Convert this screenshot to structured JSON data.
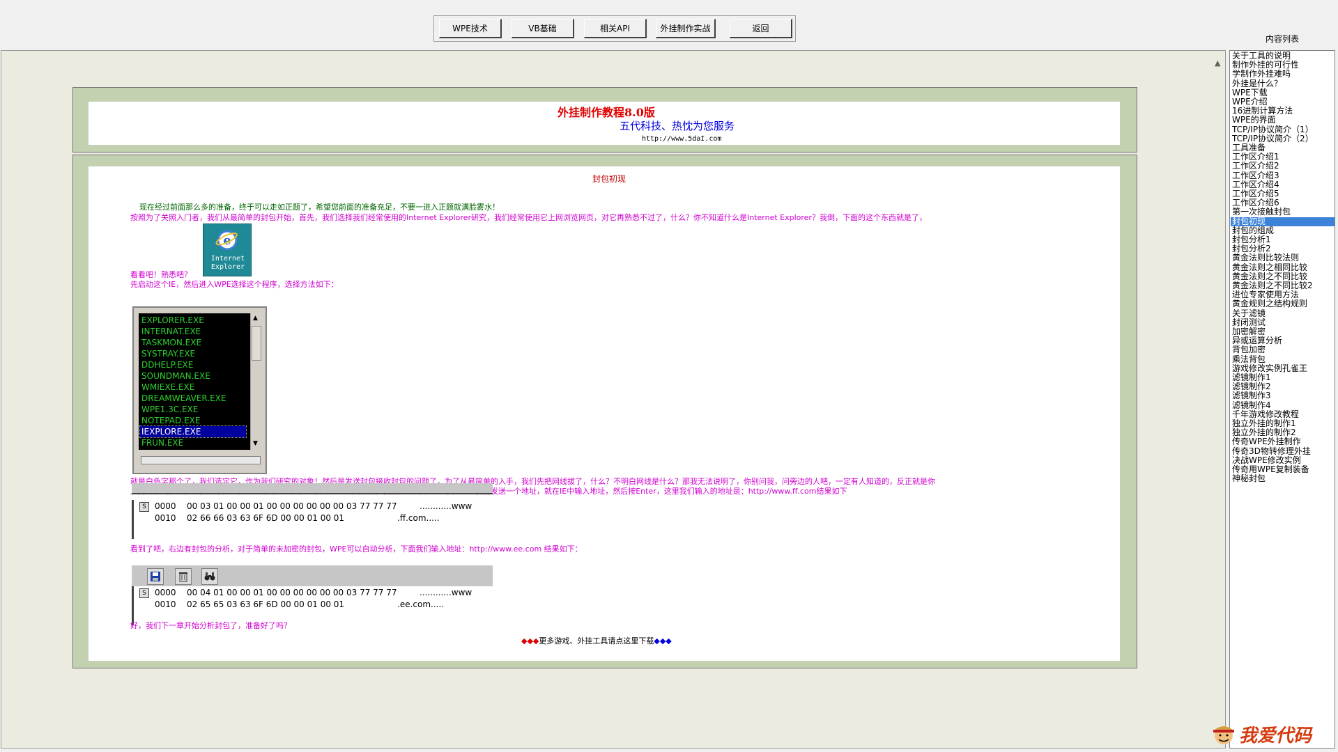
{
  "toolbar": {
    "buttons": [
      "WPE技术",
      "VB基础",
      "相关API",
      "外挂制作实战",
      "返回"
    ]
  },
  "header": {
    "title": "外挂制作教程8.0版",
    "subtitle": "五代科技、热忱为您服务",
    "url": "http://www.5daI.com"
  },
  "article": {
    "heading": "封包初现",
    "p1": "现在经过前面那么多的准备，终于可以走如正题了，希望您前面的准备充足，不要一进入正题就满脸雾水！",
    "p2": "按照为了关照入门者，我们从最简单的封包开始，首先，我们选择我们经常使用的Internet Explorer研究，我们经常使用它上网浏览网页，对它再熟悉不过了，什么？你不知道什么是Internet Explorer？我倒，下面的这个东西就是了，",
    "ie_label_1": "Internet",
    "ie_label_2": "Explorer",
    "p3": "看看吧！熟悉吧？",
    "p4": "先启动这个IE，然后进入WPE选择这个程序，选择方法如下：",
    "processes": [
      "EXPLORER.EXE",
      "INTERNAT.EXE",
      "TASKMON.EXE",
      "SYSTRAY.EXE",
      "DDHELP.EXE",
      "SOUNDMAN.EXE",
      "WMIEXE.EXE",
      "DREAMWEAVER.EXE",
      "WPE1.3C.EXE",
      "NOTEPAD.EXE",
      "IEXPLORE.EXE",
      "FRUN.EXE"
    ],
    "selected_process": "IEXPLORE.EXE",
    "p5a": "就是白色字那个了，我们选定它，作为我们研究的对象！然后是发送封包接收封包的问题了，为了从最简单的入手，我们先把网线拔了，什么？不明白网线是什么？那我无法说明了，你别问我，问旁边的人吧，一定有人知道的，反正就是你",
    "p5b": "上网那根线，先把它拔下来，这样就没有封包返回，方便研究！下面看看，我们从最简单的入手，首先我们发送一个地址，就在IE中输入地址，然后按Enter，这里我们输入的地址是：http://www.ff.com结果如下",
    "hex1": [
      {
        "offset": "0000",
        "bytes": "00 03 01 00 00 01 00 00 00 00 00 00 03 77 77 77",
        "ascii": "............www"
      },
      {
        "offset": "0010",
        "bytes": "02 66 66 03 63 6F 6D 00 00 01 00 01",
        "ascii": ".ff.com....."
      }
    ],
    "p6": "看到了吧，右边有封包的分析，对于简单的未加密的封包，WPE可以自动分析，下面我们输入地址：http://www.ee.com 结果如下：",
    "hex2": [
      {
        "offset": "0000",
        "bytes": "00 04 01 00 00 01 00 00 00 00 00 00 03 77 77 77",
        "ascii": "............www"
      },
      {
        "offset": "0010",
        "bytes": "02 65 65 03 63 6F 6D 00 00 01 00 01",
        "ascii": ".ee.com....."
      }
    ],
    "hex_s": "S",
    "p7": "好，我们下一章开始分析封包了，准备好了吗？",
    "more_link": "更多游戏、外挂工具请点这里下载",
    "diamonds_left": "◆◆◆",
    "diamonds_right": "◆◆◆"
  },
  "sidebar": {
    "title": "内容列表",
    "items": [
      "关于工具的说明",
      "制作外挂的可行性",
      "学制作外挂难吗",
      "外挂是什么？",
      "WPE下载",
      "WPE介绍",
      "16进制计算方法",
      "WPE的界面",
      "TCP/IP协议简介（1）",
      "TCP/IP协议简介（2）",
      "工具准备",
      "工作区介绍1",
      "工作区介绍2",
      "工作区介绍3",
      "工作区介绍4",
      "工作区介绍5",
      "工作区介绍6",
      "第一次接触封包",
      "封包初现",
      "封包的组成",
      "封包分析1",
      "封包分析2",
      "黄金法则比较法则",
      "黄金法则之相同比较",
      "黄金法则之不同比较",
      "黄金法则之不同比较2",
      "进位专家使用方法",
      "黄金规则之结构规则",
      "关于滤镜",
      "封闭测试",
      "加密解密",
      "异或运算分析",
      "背包加密",
      "乘法背包",
      "游戏修改实例孔雀王",
      "滤镜制作1",
      "滤镜制作2",
      "滤镜制作3",
      "滤镜制作4",
      "千年游戏修改教程",
      "独立外挂的制作1",
      "独立外挂的制作2",
      "传奇WPE外挂制作",
      "传奇3D物转修理外挂",
      "决战WPE修改实例",
      "传奇用WPE复制装备",
      "神秘封包"
    ],
    "selected_index": 18
  },
  "watermark": "我爱代码",
  "colors": {
    "frame": "#c3d1b1",
    "magenta": "#d000d0",
    "selection": "#3b82d8"
  }
}
